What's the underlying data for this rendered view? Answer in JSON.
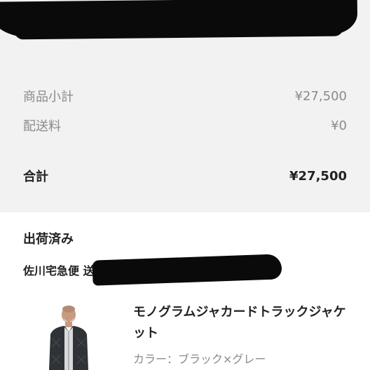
{
  "summary": {
    "subtotal_label": "商品小計",
    "subtotal_value": "¥27,500",
    "shipping_label": "配送料",
    "shipping_value": "¥0",
    "total_label": "合計",
    "total_value": "¥27,500"
  },
  "shipment": {
    "status": "出荷済み",
    "carrier": "佐川宅急便 送り状"
  },
  "product": {
    "name": "モノグラムジャカードトラックジャケット",
    "color": "カラー：ブラック×グレー",
    "thumbnail_icon": "product-photo"
  },
  "colors": {
    "summary_bg": "#f2f2f2",
    "card_bg": "#ffffff",
    "muted_text": "#8a8a8a",
    "text": "#222222"
  }
}
